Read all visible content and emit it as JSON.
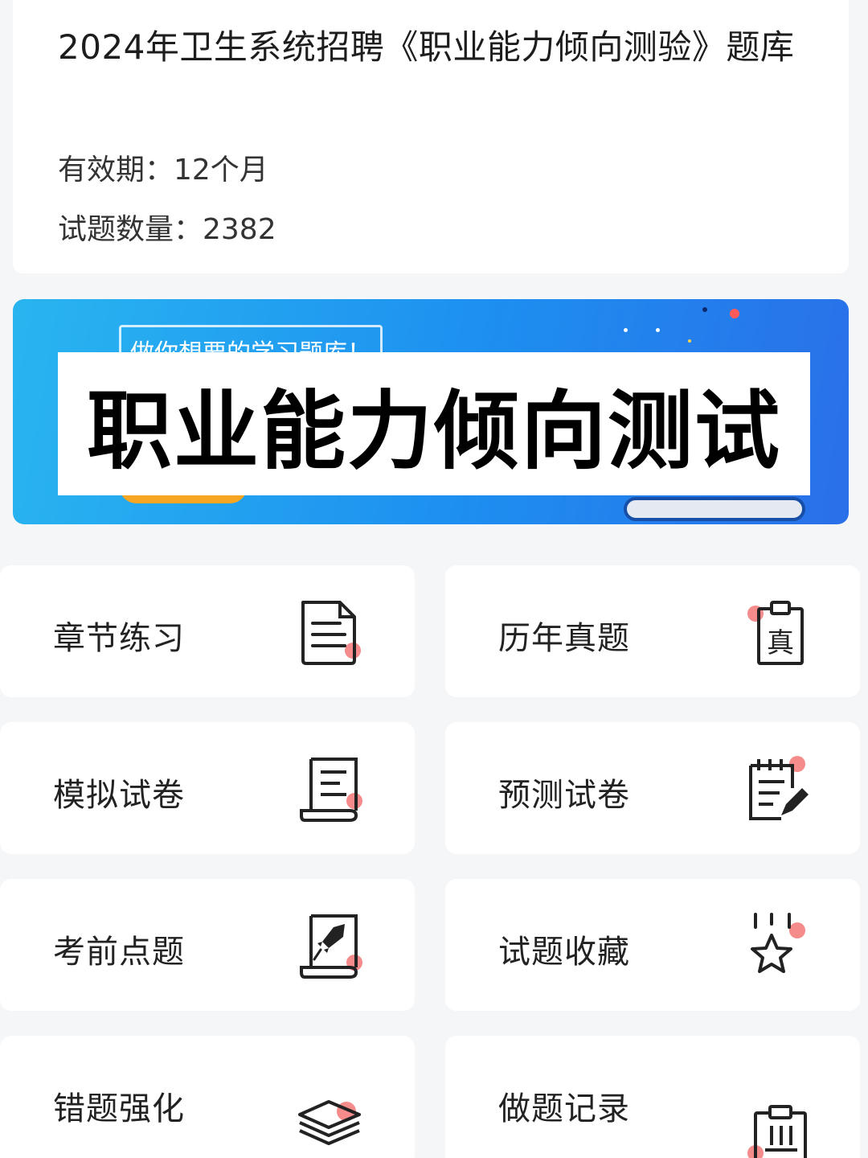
{
  "info": {
    "title": "2024年卫生系统招聘《职业能力倾向测验》题库",
    "validity": "有效期：12个月",
    "question_count": "试题数量：2382"
  },
  "banner": {
    "subtitle": "做你想要的学习题库！",
    "title": "职业能力倾向测试"
  },
  "menu": [
    {
      "label": "章节练习",
      "icon": "document-icon"
    },
    {
      "label": "历年真题",
      "icon": "clipboard-zhen-icon"
    },
    {
      "label": "模拟试卷",
      "icon": "scroll-icon"
    },
    {
      "label": "预测试卷",
      "icon": "notepad-pencil-icon"
    },
    {
      "label": "考前点题",
      "icon": "rocket-icon"
    },
    {
      "label": "试题收藏",
      "icon": "star-icon"
    },
    {
      "label": "错题强化",
      "icon": "layers-icon"
    },
    {
      "label": "做题记录",
      "icon": "clipboard-list-icon"
    }
  ],
  "colors": {
    "banner_start": "#29b5f0",
    "banner_end": "#2a6fe8",
    "accent_dot": "#f58b8b",
    "page_bg": "#f5f6f8"
  }
}
